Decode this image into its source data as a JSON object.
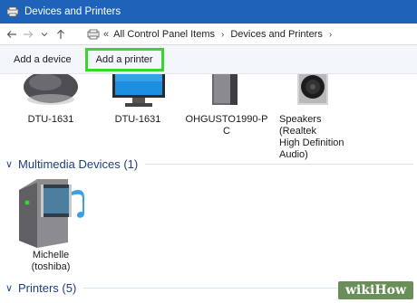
{
  "window": {
    "title": "Devices and Printers"
  },
  "nav": {
    "back_icon": "arrow-left-icon",
    "forward_icon": "arrow-right-icon",
    "recent_icon": "chevron-down-icon",
    "up_icon": "arrow-up-icon"
  },
  "address": {
    "lead": "«",
    "crumbs": [
      "All Control Panel Items",
      "Devices and Printers"
    ]
  },
  "commands": {
    "add_device": "Add a device",
    "add_printer": "Add a printer",
    "highlight_color": "#39d62b"
  },
  "devices": [
    {
      "label": "DTU-1631",
      "icon": "mouse-icon"
    },
    {
      "label": "DTU-1631",
      "icon": "monitor-icon"
    },
    {
      "label": "OHGUSTO1990-P\nC",
      "icon": "computer-tower-icon"
    },
    {
      "label": "Speakers (Realtek\nHigh Definition\nAudio)",
      "icon": "speaker-icon"
    }
  ],
  "groups": {
    "multimedia": {
      "title": "Multimedia Devices (1)"
    },
    "printers": {
      "title": "Printers (5)"
    }
  },
  "multimedia_devices": [
    {
      "label": "Michelle\n(toshiba)",
      "icon": "media-server-icon"
    }
  ],
  "watermark": {
    "prefix": "wiki",
    "suffix": "How"
  },
  "colors": {
    "titlebar": "#1e63b9",
    "group_title": "#1e3f7a",
    "cmdbar": "#f3f6fb"
  }
}
